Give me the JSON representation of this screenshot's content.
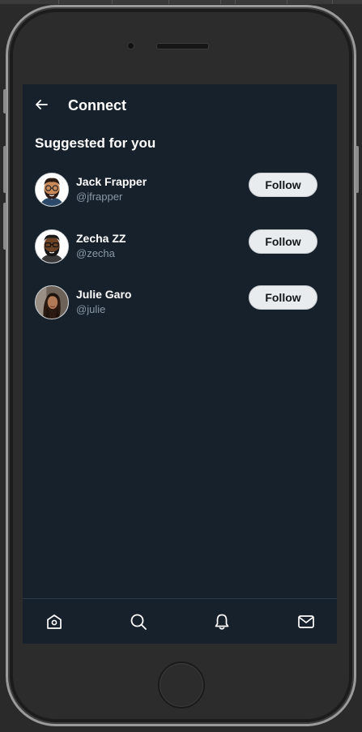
{
  "header": {
    "title": "Connect"
  },
  "section_title": "Suggested for you",
  "users": [
    {
      "name": "Jack Frapper",
      "handle": "@jfrapper",
      "follow_label": "Follow",
      "avatar": "bearded-man-glasses-avatar"
    },
    {
      "name": "Zecha ZZ",
      "handle": "@zecha",
      "follow_label": "Follow",
      "avatar": "dark-bearded-man-glasses-avatar"
    },
    {
      "name": "Julie Garo",
      "handle": "@julie",
      "follow_label": "Follow",
      "avatar": "woman-photo-avatar"
    }
  ],
  "tabbar": {
    "icons": [
      "home-icon",
      "search-icon",
      "bell-icon",
      "mail-icon"
    ]
  },
  "colors": {
    "screen_bg": "#17212b",
    "text_primary": "#ffffff",
    "text_secondary": "#8899a6",
    "button_bg": "#e9ecef",
    "button_text": "#14171a"
  }
}
